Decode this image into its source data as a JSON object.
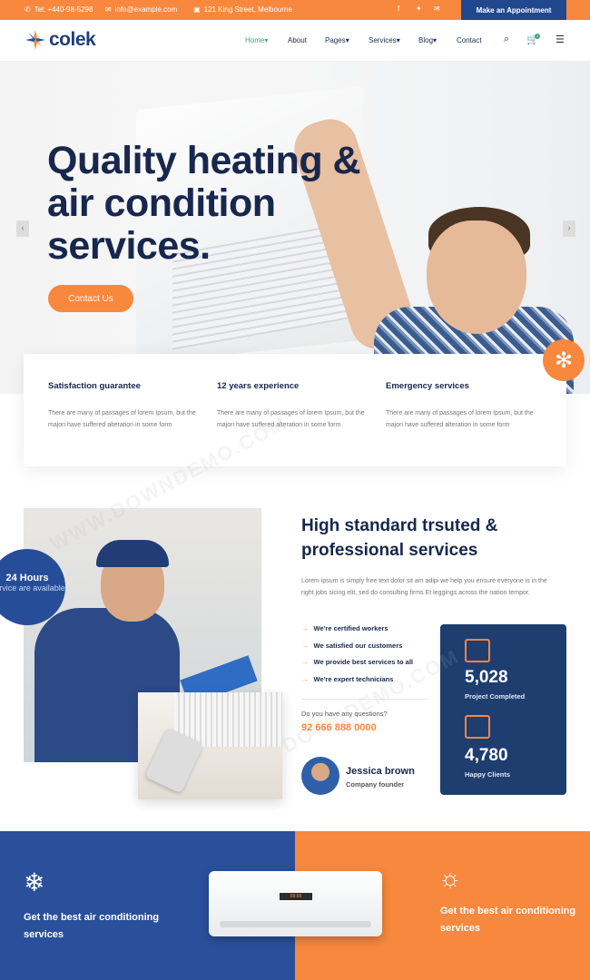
{
  "topbar": {
    "phone": "Tel: +440-98-5298",
    "email": "info@example.com",
    "address": "121 King Street, Melbourne",
    "appointment": "Make an Appointment"
  },
  "nav": {
    "logo": "colek",
    "items": [
      {
        "label": "Home"
      },
      {
        "label": "About"
      },
      {
        "label": "Pages"
      },
      {
        "label": "Services"
      },
      {
        "label": "Blog"
      },
      {
        "label": "Contact"
      }
    ],
    "cart_count": "1"
  },
  "hero": {
    "title": "Quality heating & air condition services.",
    "cta": "Contact Us"
  },
  "features": [
    {
      "title": "Satisfaction guarantee",
      "text": "There are many of passages of lorem Ipsum, but the majori have suffered alteration in some form"
    },
    {
      "title": "12 years experience",
      "text": "There are many of passages of lorem Ipsum, but the majori have suffered alteration in some form"
    },
    {
      "title": "Emergency services",
      "text": "There are many of passages of lorem Ipsum, but the majori have suffered alteration in some form"
    }
  ],
  "about": {
    "badge_title": "24 Hours",
    "badge_sub": "Service are available",
    "title": "High standard trsuted & professional services",
    "desc": "Lorem ipsum is simply free text dolor sit am adipi we help you ensure everyone is in the right jobs sicing elit, sed do consulting firms Et leggings across the nation tempor.",
    "checks": [
      "We're certified workers",
      "We satisfied our customers",
      "We provide best services to all",
      "We're expert technicians"
    ],
    "question": "Do you have any questions?",
    "phone": "92 666 888 0000",
    "founder_name": "Jessica brown",
    "founder_role": "Company founder"
  },
  "stats": [
    {
      "value": "5,028",
      "label": "Project Completed"
    },
    {
      "value": "4,780",
      "label": "Happy Clients"
    }
  ],
  "cta": {
    "left_text": "Get the best air conditioning services",
    "right_text": "Get the best air conditioning services",
    "left_icon": "snowflake-icon",
    "right_icon": "sun-icon",
    "unit_display": "88:88"
  },
  "colors": {
    "accent": "#f7883e",
    "primary": "#21488f",
    "navy": "#17274d"
  }
}
